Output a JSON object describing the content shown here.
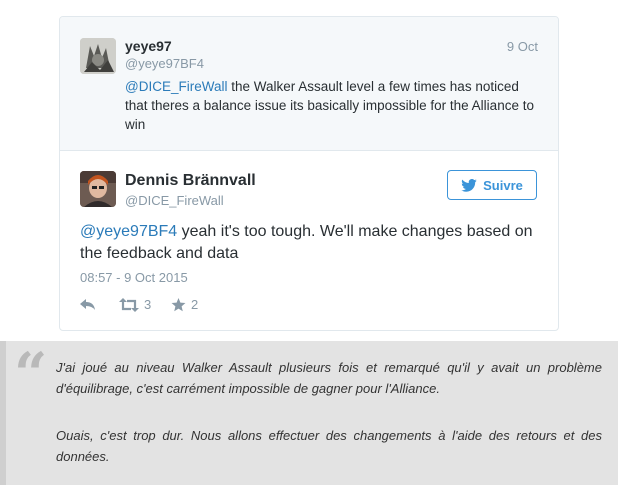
{
  "parent_tweet": {
    "name": "yeye97",
    "handle": "@yeye97BF4",
    "date": "9 Oct",
    "mention": "@DICE_FireWall",
    "text": " the Walker Assault level a few times has noticed that theres a balance issue its basically impossible for the Alliance to win"
  },
  "main_tweet": {
    "name": "Dennis Brännvall",
    "handle": "@DICE_FireWall",
    "follow_label": "Suivre",
    "mention": "@yeye97BF4",
    "text": " yeah it's too tough. We'll make changes based on the feedback and data",
    "timestamp": "08:57 - 9 Oct 2015",
    "retweets": "3",
    "likes": "2"
  },
  "translation": {
    "paragraph1": "J'ai joué au niveau Walker Assault plusieurs fois et remarqué qu'il y avait un problème d'équilibrage, c'est carrément impossible de gagner pour l'Alliance.",
    "paragraph2": "Ouais, c'est trop dur. Nous allons effectuer des changements à l'aide des retours et des données."
  },
  "colors": {
    "link": "#2b7bb9",
    "twitter_blue": "#3b94d9",
    "muted": "#8899a6"
  },
  "icons": [
    "user-avatar",
    "twitter-bird-icon",
    "reply-icon",
    "retweet-icon",
    "star-icon",
    "quote-icon"
  ]
}
